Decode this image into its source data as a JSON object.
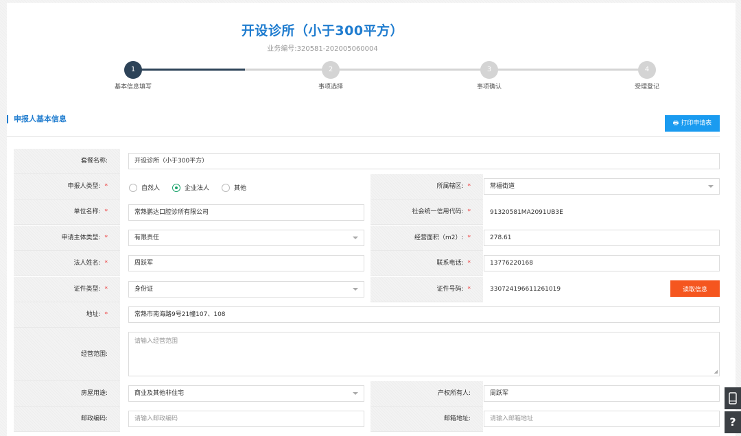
{
  "header": {
    "title": "开设诊所（小于300平方）",
    "biz_no_label": "业务编号:",
    "biz_no": "320581-202005060004"
  },
  "steps": [
    {
      "num": "1",
      "label": "基本信息填写",
      "state": "active"
    },
    {
      "num": "2",
      "label": "事项选择",
      "state": "pending"
    },
    {
      "num": "3",
      "label": "事项确认",
      "state": "pending"
    },
    {
      "num": "4",
      "label": "受理登记",
      "state": "pending"
    }
  ],
  "section": {
    "title": "申报人基本信息",
    "print_button": "打印申请表",
    "print_icon": "printer-icon"
  },
  "form": {
    "package_name": {
      "label": "套餐名称:",
      "value": "开设诊所（小于300平方）"
    },
    "applicant_type": {
      "label": "申报人类型:",
      "options": [
        "自然人",
        "企业法人",
        "其他"
      ],
      "selected": "企业法人"
    },
    "district": {
      "label": "所属辖区:",
      "value": "常福街道"
    },
    "org_name": {
      "label": "单位名称:",
      "value": "常熟鹏达口腔诊所有限公司"
    },
    "credit_code": {
      "label": "社会统一信用代码:",
      "value": "91320581MA2091UB3E"
    },
    "entity_type": {
      "label": "申请主体类型:",
      "value": "有限责任"
    },
    "area": {
      "label": "经营面积（m2）:",
      "value": "278.61"
    },
    "legal_name": {
      "label": "法人姓名:",
      "value": "周跃军"
    },
    "phone": {
      "label": "联系电话:",
      "value": "13776220168"
    },
    "id_type": {
      "label": "证件类型:",
      "value": "身份证"
    },
    "id_no": {
      "label": "证件号码:",
      "value": "330724196611261019"
    },
    "read_button": "读取信息",
    "address": {
      "label": "地址:",
      "value": "常熟市南海路9号21幢107、108"
    },
    "scope": {
      "label": "经营范围:",
      "placeholder": "请输入经营范围"
    },
    "usage": {
      "label": "房屋用途:",
      "value": "商业及其他非住宅"
    },
    "owner": {
      "label": "产权所有人:",
      "value": "周跃军"
    },
    "postcode": {
      "label": "邮政编码:",
      "placeholder": "请输入邮政编码"
    },
    "mail_addr": {
      "label": "邮箱地址:",
      "placeholder": "请输入邮箱地址"
    }
  },
  "required_mark": "*",
  "side": {
    "phone_icon": "tablet-icon",
    "help": "?"
  }
}
